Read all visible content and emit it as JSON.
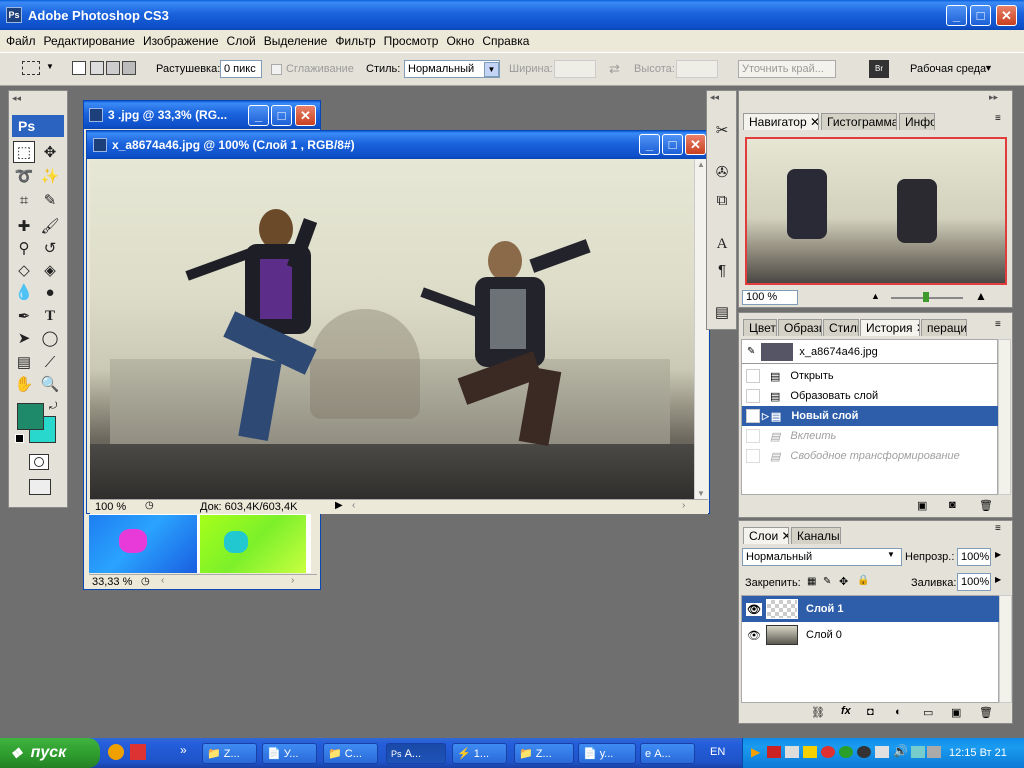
{
  "app": {
    "title": "Adobe Photoshop CS3",
    "icon": "Ps"
  },
  "menu": [
    "Файл",
    "Редактирование",
    "Изображение",
    "Слой",
    "Выделение",
    "Фильтр",
    "Просмотр",
    "Окно",
    "Справка"
  ],
  "options": {
    "feather_label": "Растушевка:",
    "feather_value": "0 пикс",
    "antialias_label": "Сглаживание",
    "style_label": "Стиль:",
    "style_value": "Нормальный",
    "width_label": "Ширина:",
    "height_label": "Высота:",
    "refine_label": "Уточнить край...",
    "workspace_label": "Рабочая среда"
  },
  "toolbox": {
    "logo": "Ps",
    "fg_color": "#1e8a6a",
    "bg_color": "#28d8cc"
  },
  "doc_back": {
    "title": "3 .jpg @ 33,3% (RG...",
    "zoom": "33,33 %"
  },
  "doc_front": {
    "title": "x_a8674a46.jpg @ 100% (Слой 1 , RGB/8#)",
    "zoom": "100 %",
    "status": "Док: 603,4K/603,4K"
  },
  "navigator": {
    "tabs": [
      "Навигатор",
      "Гистограмма",
      "Инфо"
    ],
    "zoom": "100 %"
  },
  "history": {
    "tabs": [
      "Цвет",
      "Образцы",
      "Стили",
      "История",
      "перации"
    ],
    "snapshot": "x_a8674a46.jpg",
    "items": [
      {
        "label": "Открыть",
        "state": "normal"
      },
      {
        "label": "Образовать слой",
        "state": "normal"
      },
      {
        "label": "Новый слой",
        "state": "selected"
      },
      {
        "label": "Вклеить",
        "state": "undone"
      },
      {
        "label": "Свободное трансформирование",
        "state": "undone"
      }
    ]
  },
  "layers": {
    "tabs": [
      "Слои",
      "Каналы"
    ],
    "blend_mode": "Нормальный",
    "opacity_label": "Непрозр.:",
    "opacity_value": "100%",
    "lock_label": "Закрепить:",
    "fill_label": "Заливка:",
    "fill_value": "100%",
    "items": [
      {
        "name": "Слой 1",
        "selected": true
      },
      {
        "name": "Слой 0",
        "selected": false
      }
    ]
  },
  "taskbar": {
    "start": "пуск",
    "buttons": [
      "Z...",
      "У...",
      "C...",
      "A...",
      "1...",
      "Z...",
      "у...",
      "A..."
    ],
    "lang": "EN",
    "clock": "12:15 Вт 21"
  }
}
